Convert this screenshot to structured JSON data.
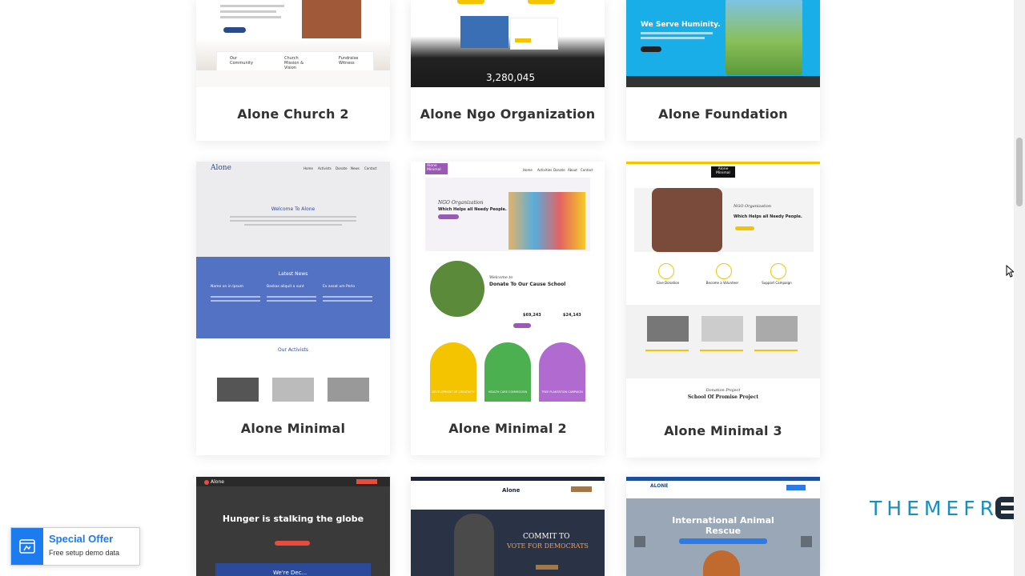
{
  "cards": [
    {
      "title": "Alone Church 2"
    },
    {
      "title": "Alone Ngo Organization"
    },
    {
      "title": "Alone Foundation"
    },
    {
      "title": "Alone Minimal"
    },
    {
      "title": "Alone Minimal 2"
    },
    {
      "title": "Alone Minimal 3"
    }
  ],
  "previews": {
    "church2": {
      "box1": "Our Community",
      "box2": "Church Mission & Vision",
      "box3": "Fundraise Witness"
    },
    "ngo": {
      "counter": "3,280,045"
    },
    "foundation": {
      "headline": "We Serve Huminity."
    },
    "minimal": {
      "logo": "Alone",
      "nav": [
        "Home",
        "Activists",
        "Donate",
        "News",
        "Contact"
      ],
      "welcome": "Welcome To Alone",
      "news_title": "Latest News",
      "news_cols": [
        "Name on in Ipsum",
        "Baskas aliquit a sunt",
        "Ex assat um Perlo"
      ],
      "activists": "Our Activists"
    },
    "minimal2": {
      "logo": "Alone Minimal",
      "nav": [
        "Home",
        "Activities",
        "Donate",
        "About",
        "Contact"
      ],
      "script": "NGO Organization",
      "hero": "Which Helps all Needy People.",
      "welcome_script": "Welcome to",
      "welcome": "Donate To Our Cause School",
      "amount1": "$69,243",
      "amount2": "$24,143",
      "circles": [
        "DEVELOPMENT OF CREATIVITY",
        "HEALTH CARE COMMISSION",
        "TREE PLANTATION CAMPAIGN"
      ]
    },
    "minimal3": {
      "logo": "Alone Minimal",
      "script": "NGO Organization",
      "hero": "Which Helps all Needy People.",
      "features": [
        "Give Donation",
        "Become a Volunteer",
        "Support Campaign"
      ],
      "donation_script": "Donation Project",
      "donation": "School Of Promise Project"
    },
    "row3": [
      {
        "logo": "Alone",
        "headline": "Hunger is stalking the globe",
        "sub": "We're Dec..."
      },
      {
        "logo": "Alone",
        "headline": "COMMIT TO",
        "headline2": "VOTE FOR DEMOCRATS"
      },
      {
        "logo": "ALONE",
        "headline": "International Animal Rescue"
      }
    ]
  },
  "special_offer": {
    "title": "Special Offer",
    "subtitle": "Free setup demo data"
  },
  "brand": {
    "name": "THEMEFR",
    "icon": "e-mark-icon"
  },
  "colors": {
    "accent": "#1d7bf0",
    "brand": "#1a8fbf",
    "yellow": "#f5c400",
    "blue": "#5472c4",
    "purple": "#9b59b6"
  }
}
